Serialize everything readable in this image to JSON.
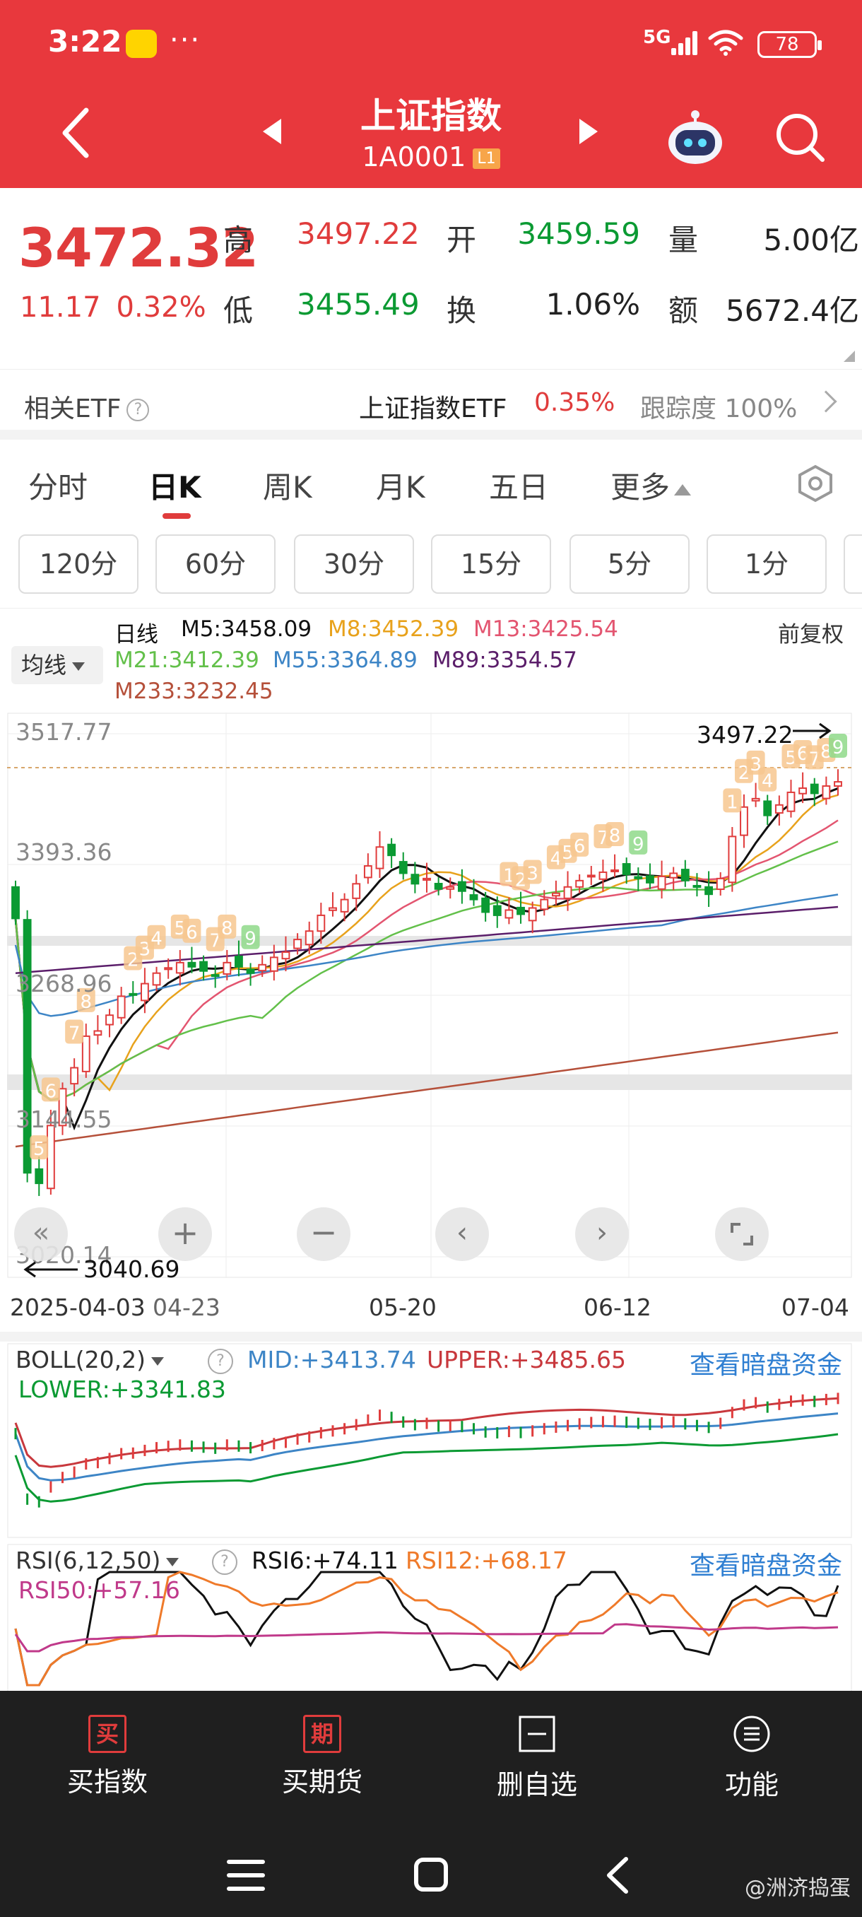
{
  "status": {
    "time": "3:22",
    "dots": "···",
    "signal": "5G",
    "battery": "78"
  },
  "header": {
    "title": "上证指数",
    "code": "1A0001",
    "level": "L1"
  },
  "quote": {
    "price": "3472.32",
    "change": "11.17",
    "change_pct": "0.32%",
    "high_label": "高",
    "high": "3497.22",
    "open_label": "开",
    "open": "3459.59",
    "volume_label": "量",
    "volume": "5.00亿",
    "low_label": "低",
    "low": "3455.49",
    "turnover_label": "换",
    "turnover": "1.06%",
    "amount_label": "额",
    "amount": "5672.4亿"
  },
  "etf": {
    "label": "相关ETF",
    "help": "?",
    "name": "上证指数ETF",
    "pct": "0.35%",
    "tracking": "跟踪度 100%"
  },
  "tabs": [
    "分时",
    "日K",
    "周K",
    "月K",
    "五日",
    "更多"
  ],
  "periods": [
    "120分",
    "60分",
    "30分",
    "15分",
    "5分",
    "1分"
  ],
  "ma_legend": {
    "selector": "均线",
    "title": "日线",
    "m5": "M5:3458.09",
    "m8": "M8:3452.39",
    "m13": "M13:3425.54",
    "m21": "M21:3412.39",
    "m55": "M55:3364.89",
    "m89": "M89:3354.57",
    "m233": "M233:3232.45",
    "adjust": "前复权"
  },
  "colors": {
    "up": "#e03c3c",
    "down": "#0b9a33",
    "m5": "#111111",
    "m8": "#e8a21c",
    "m13": "#e35570",
    "m21": "#63c04a",
    "m55": "#3d85c6",
    "m89": "#5b1e6a",
    "m233": "#b5503a"
  },
  "axis": {
    "y_labels": [
      "3517.77",
      "3393.36",
      "3268.96",
      "3144.55",
      "3020.14"
    ],
    "x_labels": [
      "2025-04-03",
      "04-23",
      "05-20",
      "06-12",
      "07-04"
    ],
    "high_marker": "3497.22",
    "low_marker": "3040.69"
  },
  "boll": {
    "selector": "BOLL(20,2)",
    "help": "?",
    "mid": "MID:+3413.74",
    "upper": "UPPER:+3485.65",
    "lower": "LOWER:+3341.83",
    "link": "查看暗盘资金"
  },
  "rsi": {
    "selector": "RSI(6,12,50)",
    "help": "?",
    "rsi6": "RSI6:+74.11",
    "rsi12": "RSI12:+68.17",
    "rsi50": "RSI50:+57.16",
    "link": "查看暗盘资金"
  },
  "bottom": {
    "items": [
      "买指数",
      "买期货",
      "删自选",
      "功能"
    ],
    "icon_buy": "买",
    "icon_futures": "期"
  },
  "watermark": "@洲济捣蛋",
  "chart_data": {
    "type": "candlestick",
    "x_range": [
      "2025-04-03",
      "2025-07-04"
    ],
    "ylim": [
      3020.14,
      3517.77
    ],
    "last_close": 3472.32,
    "high_marked": 3497.22,
    "low_marked": 3040.69,
    "closes": [
      3342,
      3100,
      3090,
      3145,
      3180,
      3200,
      3230,
      3235,
      3250,
      3268,
      3270,
      3280,
      3290,
      3295,
      3300,
      3296,
      3292,
      3288,
      3300,
      3296,
      3290,
      3298,
      3305,
      3310,
      3322,
      3330,
      3345,
      3352,
      3360,
      3375,
      3392,
      3410,
      3402,
      3385,
      3375,
      3380,
      3370,
      3372,
      3368,
      3360,
      3348,
      3345,
      3350,
      3346,
      3352,
      3360,
      3366,
      3372,
      3378,
      3383,
      3386,
      3388,
      3384,
      3380,
      3376,
      3382,
      3385,
      3378,
      3372,
      3365,
      3380,
      3420,
      3448,
      3456,
      3440,
      3450,
      3462,
      3466,
      3461,
      3468,
      3472
    ]
  }
}
